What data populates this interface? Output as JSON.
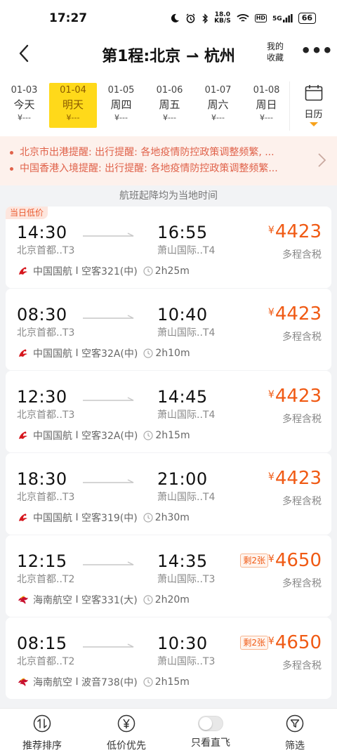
{
  "status_bar": {
    "time": "17:27",
    "speed_value": "18.0",
    "speed_unit": "KB/S",
    "hd": "HD",
    "signal": "5G",
    "battery": "66"
  },
  "header": {
    "title": "第1程:北京 ⇀ 杭州",
    "favorite_label_1": "我的",
    "favorite_label_2": "收藏",
    "more": "•••"
  },
  "dates": [
    {
      "date": "01-03",
      "weekday": "今天",
      "price": "¥---"
    },
    {
      "date": "01-04",
      "weekday": "明天",
      "price": "¥---",
      "selected": true
    },
    {
      "date": "01-05",
      "weekday": "周四",
      "price": "¥---"
    },
    {
      "date": "01-06",
      "weekday": "周五",
      "price": "¥---"
    },
    {
      "date": "01-07",
      "weekday": "周六",
      "price": "¥---"
    },
    {
      "date": "01-08",
      "weekday": "周日",
      "price": "¥---"
    }
  ],
  "calendar_label": "日历",
  "notices": [
    "北京市出港提醒: 出行提醒:  各地疫情防控政策调整频繁, ...",
    "中国香港入境提醒: 出行提醒:  各地疫情防控政策调整频繁..."
  ],
  "timezone_note": "航班起降均为当地时间",
  "flights": [
    {
      "badge": "当日低价",
      "dep_time": "14:30",
      "dep_airport": "北京首都..T3",
      "arr_time": "16:55",
      "arr_airport": "萧山国际..T4",
      "currency": "¥",
      "price": "4423",
      "remain": "",
      "tax_note": "多程含税",
      "airline": "中国国航",
      "aircraft": "空客321(中)",
      "duration": "2h25m",
      "logo": "air-china"
    },
    {
      "badge": "",
      "dep_time": "08:30",
      "dep_airport": "北京首都..T3",
      "arr_time": "10:40",
      "arr_airport": "萧山国际..T4",
      "currency": "¥",
      "price": "4423",
      "remain": "",
      "tax_note": "多程含税",
      "airline": "中国国航",
      "aircraft": "空客32A(中)",
      "duration": "2h10m",
      "logo": "air-china"
    },
    {
      "badge": "",
      "dep_time": "12:30",
      "dep_airport": "北京首都..T3",
      "arr_time": "14:45",
      "arr_airport": "萧山国际..T4",
      "currency": "¥",
      "price": "4423",
      "remain": "",
      "tax_note": "多程含税",
      "airline": "中国国航",
      "aircraft": "空客32A(中)",
      "duration": "2h15m",
      "logo": "air-china"
    },
    {
      "badge": "",
      "dep_time": "18:30",
      "dep_airport": "北京首都..T3",
      "arr_time": "21:00",
      "arr_airport": "萧山国际..T4",
      "currency": "¥",
      "price": "4423",
      "remain": "",
      "tax_note": "多程含税",
      "airline": "中国国航",
      "aircraft": "空客319(中)",
      "duration": "2h30m",
      "logo": "air-china"
    },
    {
      "badge": "",
      "dep_time": "12:15",
      "dep_airport": "北京首都..T2",
      "arr_time": "14:35",
      "arr_airport": "萧山国际..T3",
      "currency": "¥",
      "price": "4650",
      "remain": "剩2张",
      "tax_note": "多程含税",
      "airline": "海南航空",
      "aircraft": "空客331(大)",
      "duration": "2h20m",
      "logo": "hainan"
    },
    {
      "badge": "",
      "dep_time": "08:15",
      "dep_airport": "北京首都..T2",
      "arr_time": "10:30",
      "arr_airport": "萧山国际..T3",
      "currency": "¥",
      "price": "4650",
      "remain": "剩2张",
      "tax_note": "多程含税",
      "airline": "海南航空",
      "aircraft": "波音738(中)",
      "duration": "2h15m",
      "logo": "hainan"
    }
  ],
  "separator": " I ",
  "bottom_tabs": [
    {
      "label": "推荐排序",
      "icon": "sort-icon"
    },
    {
      "label": "低价优先",
      "icon": "yen-icon"
    },
    {
      "label": "只看直飞",
      "icon": "toggle"
    },
    {
      "label": "筛选",
      "icon": "filter-icon"
    }
  ],
  "colors": {
    "accent": "#ffd91a",
    "price": "#f05a14",
    "notice": "#e0624a",
    "air_china_red": "#d6171e",
    "hainan_red": "#c8102e"
  }
}
